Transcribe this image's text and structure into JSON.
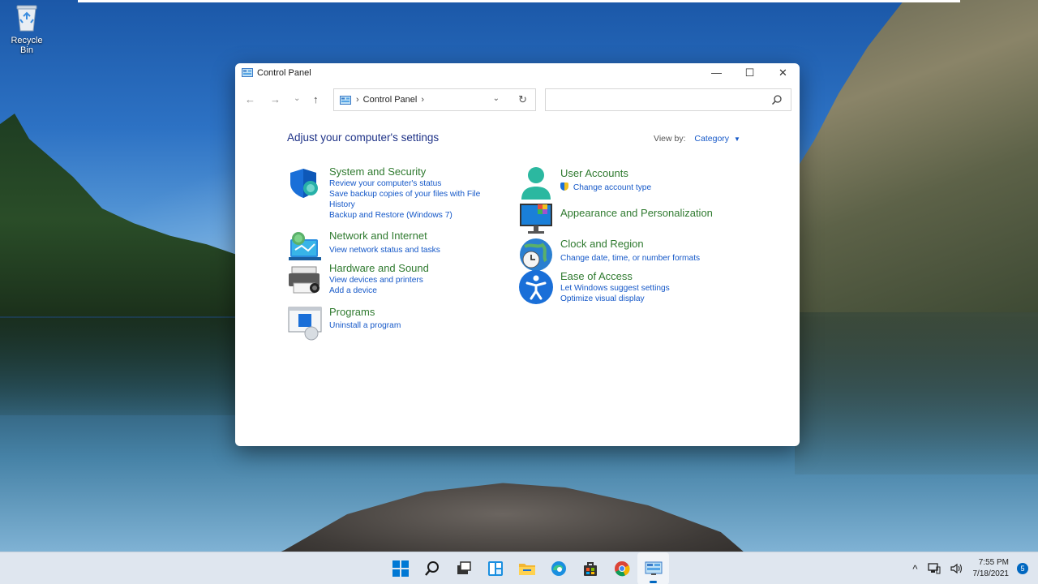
{
  "desktop": {
    "recycle_bin_label": "Recycle Bin"
  },
  "window": {
    "title": "Control Panel",
    "controls": {
      "minimize": "—",
      "maximize": "☐",
      "close": "✕"
    },
    "nav": {
      "back": "←",
      "forward": "→",
      "recent": "⌄",
      "up": "↑"
    },
    "address": {
      "path_label": "Control Panel",
      "separator_before": "›",
      "separator_after": "›",
      "dropdown": "⌄",
      "refresh": "↻"
    },
    "search": {
      "value": "",
      "placeholder": ""
    },
    "heading": "Adjust your computer's settings",
    "view_by": {
      "label": "View by:",
      "value": "Category",
      "caret": "▼"
    },
    "categories_left": [
      {
        "title": "System and Security",
        "links": [
          "Review your computer's status",
          "Save backup copies of your files with File",
          "History",
          "Backup and Restore (Windows 7)"
        ],
        "icon": "shield-icon"
      },
      {
        "title": "Network and Internet",
        "links": [
          "View network status and tasks"
        ],
        "icon": "network-icon"
      },
      {
        "title": "Hardware and Sound",
        "links": [
          "View devices and printers",
          "Add a device"
        ],
        "icon": "printer-icon"
      },
      {
        "title": "Programs",
        "links": [
          "Uninstall a program"
        ],
        "icon": "programs-icon"
      }
    ],
    "categories_right": [
      {
        "title": "User Accounts",
        "links": [
          "Change account type"
        ],
        "icon": "user-icon"
      },
      {
        "title": "Appearance and Personalization",
        "links": [],
        "icon": "monitor-icon"
      },
      {
        "title": "Clock and Region",
        "links": [
          "Change date, time, or number formats"
        ],
        "icon": "clock-globe-icon"
      },
      {
        "title": "Ease of Access",
        "links": [
          "Let Windows suggest settings",
          "Optimize visual display"
        ],
        "icon": "accessibility-icon"
      }
    ]
  },
  "taskbar": {
    "icons": [
      "windows-start-icon",
      "search-icon",
      "task-view-icon",
      "widgets-icon",
      "file-explorer-icon",
      "edge-icon",
      "store-icon",
      "chrome-icon",
      "control-panel-icon"
    ],
    "tray": {
      "chevron": "^",
      "time": "7:55 PM",
      "date": "7/18/2021",
      "notifications": "5"
    }
  },
  "colors": {
    "accent": "#0067c0",
    "link": "#1558c8",
    "category_title": "#2f7a2f",
    "heading": "#1e3287"
  }
}
